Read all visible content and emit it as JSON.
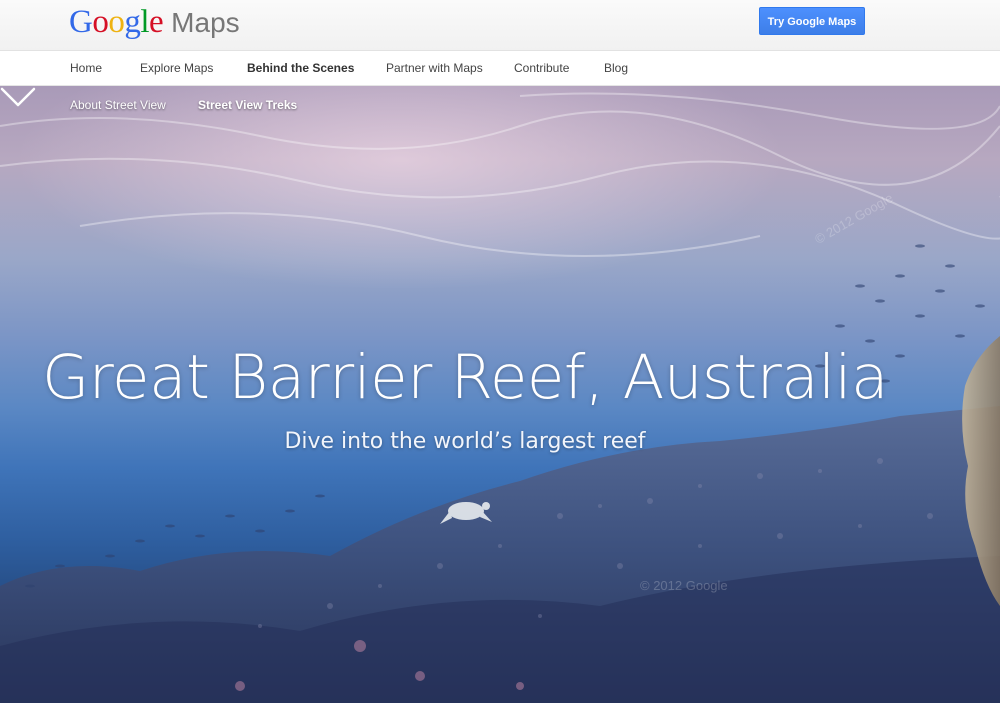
{
  "header": {
    "logo_google": "Google",
    "logo_product": "Maps",
    "logo_colors": [
      "#3369e8",
      "#d50f25",
      "#eeb211",
      "#3369e8",
      "#009925",
      "#d50f25"
    ],
    "cta_label": "Try Google Maps"
  },
  "nav": {
    "items": [
      {
        "label": "Home"
      },
      {
        "label": "Explore Maps"
      },
      {
        "label": "Behind the Scenes"
      },
      {
        "label": "Partner with Maps"
      },
      {
        "label": "Contribute"
      },
      {
        "label": "Blog"
      }
    ],
    "active": "Behind the Scenes"
  },
  "subnav": {
    "items": [
      {
        "label": "About Street View"
      },
      {
        "label": "Street View Treks"
      }
    ],
    "active": "Street View Treks"
  },
  "hero": {
    "title": "Great Barrier Reef, Australia",
    "subtitle": "Dive into the world’s largest reef",
    "watermarks": [
      "© 2012 Google",
      "© 2012 Google"
    ]
  },
  "icons": {
    "scroll": "chevron-down-icon"
  },
  "colors": {
    "accent": "#4d90fe",
    "ocean_deep": "#1c3866",
    "ocean_surface": "#b7a8c0"
  }
}
